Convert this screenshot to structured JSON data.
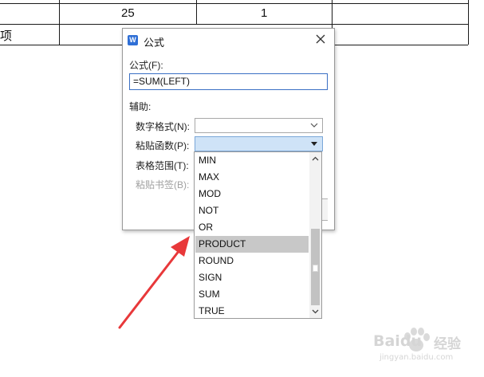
{
  "document": {
    "row1": {
      "cell2": "25",
      "cell3": "1"
    },
    "row2": {
      "cell1": "项"
    }
  },
  "dialog": {
    "title": "公式",
    "formula_label": "公式(F):",
    "formula_value": "=SUM(LEFT)",
    "assist_label": "辅助:",
    "number_format_label": "数字格式(N):",
    "paste_function_label": "粘贴函数(P):",
    "table_range_label": "表格范围(T):",
    "paste_bookmark_label": "粘贴书签(B):"
  },
  "dropdown": {
    "items": [
      "MIN",
      "MAX",
      "MOD",
      "NOT",
      "OR",
      "PRODUCT",
      "ROUND",
      "SIGN",
      "SUM",
      "TRUE"
    ],
    "selected": "PRODUCT"
  },
  "watermark": {
    "brand": "Baidu",
    "sub": "经验",
    "url": "jingyan.baidu.com"
  },
  "colors": {
    "accent": "#3a6fc4",
    "open_select_bg": "#cfe3f7",
    "selected_item_bg": "#c8c8c8",
    "arrow": "#e8383a"
  },
  "icons": [
    "app-icon",
    "close-icon",
    "chevron-down-icon",
    "scroll-up-icon",
    "scroll-down-icon",
    "red-arrow"
  ]
}
